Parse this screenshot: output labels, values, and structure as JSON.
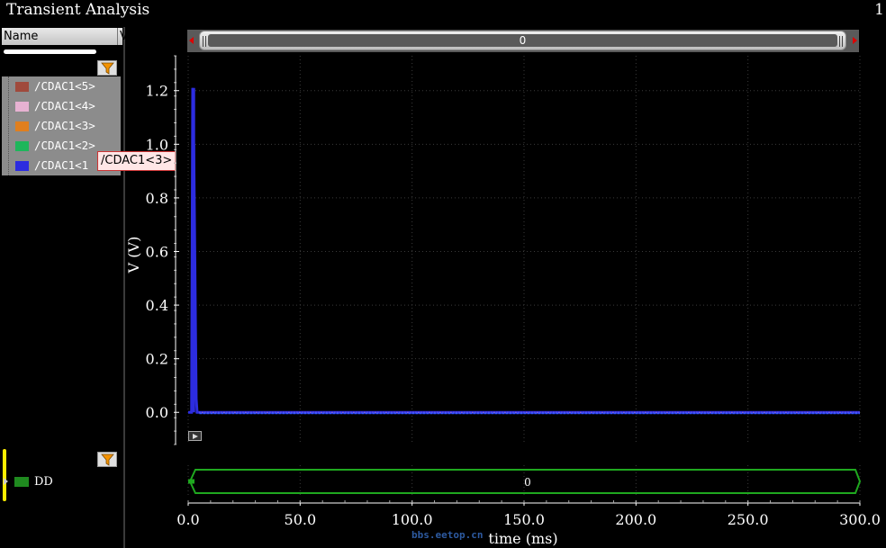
{
  "window": {
    "title": "Transient Analysis",
    "page_number": "1"
  },
  "signal_panel": {
    "column_name": "Name",
    "column_v": "V",
    "signals": [
      {
        "label": "/CDAC1<5>",
        "color": "#a04a3c"
      },
      {
        "label": "/CDAC1<4>",
        "color": "#e7b2d2"
      },
      {
        "label": "/CDAC1<3>",
        "color": "#e07f1e"
      },
      {
        "label": "/CDAC1<2>",
        "color": "#1eb65b"
      },
      {
        "label": "/CDAC1<1",
        "color": "#2c2ce0"
      }
    ],
    "tooltip": "/CDAC1<3>",
    "bus_label": "DD",
    "bus_color": "#1f8a1f"
  },
  "scrollbar": {
    "value": "0"
  },
  "bus_value": "0",
  "watermark": "bbs.eetop.cn",
  "chart_data": {
    "type": "line",
    "ylabel": "V (V)",
    "xlabel": "time (ms)",
    "xlim": [
      0,
      300
    ],
    "ylim": [
      -0.12,
      1.33
    ],
    "x_ticks": [
      "0.0",
      "50.0",
      "100.0",
      "150.0",
      "200.0",
      "250.0",
      "300.0"
    ],
    "y_ticks": [
      "0.0",
      "0.2",
      "0.4",
      "0.6",
      "0.8",
      "1.0",
      "1.2"
    ],
    "grid": true,
    "series": [
      {
        "name": "/CDAC1<1",
        "color": "#2c2ce0",
        "x": [
          0,
          1.5,
          2.0,
          2.2,
          2.5,
          3.0,
          3.3,
          3.6,
          4.0,
          5.0,
          300
        ],
        "y": [
          0.0,
          0.0,
          1.21,
          0.6,
          1.0,
          0.57,
          0.3,
          0.05,
          0.0,
          0.0,
          0.0
        ]
      }
    ]
  }
}
